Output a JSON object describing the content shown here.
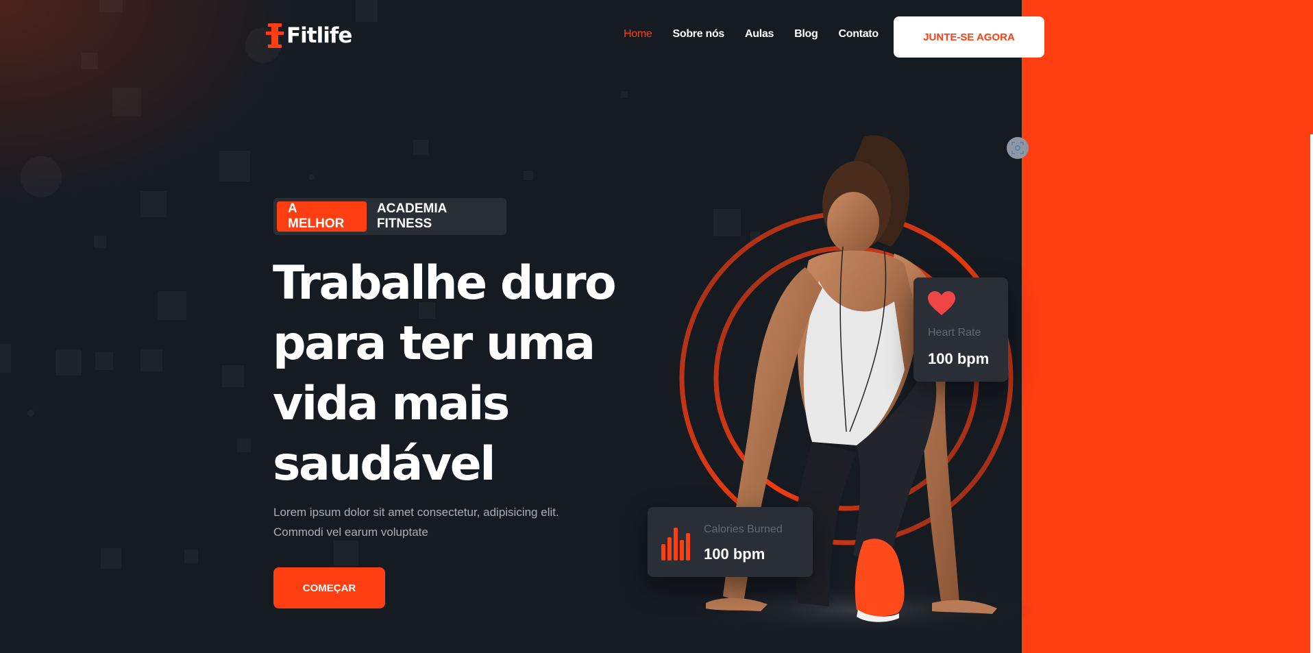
{
  "brand": {
    "name": "Fitlife"
  },
  "nav": {
    "items": [
      {
        "label": "Home",
        "active": true
      },
      {
        "label": "Sobre nós",
        "active": false
      },
      {
        "label": "Aulas",
        "active": false
      },
      {
        "label": "Blog",
        "active": false
      },
      {
        "label": "Contato",
        "active": false
      }
    ],
    "cta_label": "JUNTE-SE AGORA"
  },
  "hero": {
    "badge_highlight": "A MELHOR",
    "badge_text": "ACADEMIA FITNESS",
    "title_lines": [
      "Trabalhe duro",
      "para ter uma",
      "vida mais",
      "saudável"
    ],
    "subtitle_line1": "Lorem ipsum dolor sit amet consectetur, adipisicing elit.",
    "subtitle_line2": "Commodi vel earum voluptate",
    "cta_label": "COMEÇAR"
  },
  "stats": {
    "heart_rate": {
      "label": "Heart Rate",
      "value": "100 bpm",
      "icon": "heart-icon"
    },
    "calories": {
      "label": "Calories Burned",
      "value": "100 bpm",
      "icon": "bar-chart-icon"
    }
  },
  "colors": {
    "accent": "#ff3e11",
    "background": "#161b22",
    "card": "#2a2f37",
    "muted_text": "#a8afba"
  }
}
